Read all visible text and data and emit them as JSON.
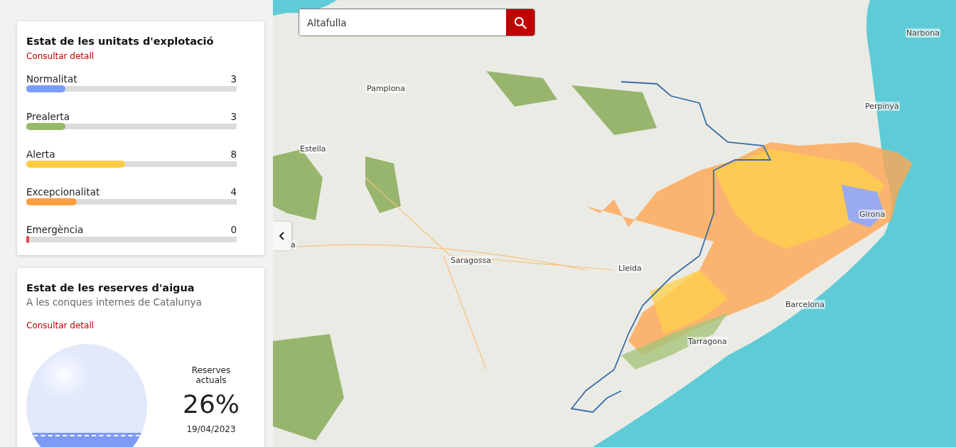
{
  "units_card": {
    "title": "Estat de les unitats d'explotació",
    "link": "Consultar detall",
    "levels": [
      {
        "label": "Normalitat",
        "count": "3",
        "level": 0.185,
        "color": "#7b9cff"
      },
      {
        "label": "Prealerta",
        "count": "3",
        "level": 0.185,
        "color": "#98b86a"
      },
      {
        "label": "Alerta",
        "count": "8",
        "level": 0.47,
        "color": "#ffcd40"
      },
      {
        "label": "Excepcionalitat",
        "count": "4",
        "level": 0.24,
        "color": "#ffa040"
      },
      {
        "label": "Emergència",
        "count": "0",
        "level": 0.015,
        "color": "#e04848"
      }
    ]
  },
  "reserves_card": {
    "title": "Estat de les reserves d'aigua",
    "subtitle": "A les conques internes de Catalunya",
    "link": "Consultar detall",
    "level": 0.26,
    "label": "Reserves actuals",
    "percent": "26%",
    "date": "19/04/2023"
  },
  "search": {
    "value": "Altafulla"
  },
  "map": {
    "labels": [
      "Narbona",
      "Pamplona",
      "Perpinyà",
      "Estella",
      "Girona",
      "a",
      "Saragossa",
      "Lleida",
      "Barcelona",
      "Tarragona"
    ]
  }
}
